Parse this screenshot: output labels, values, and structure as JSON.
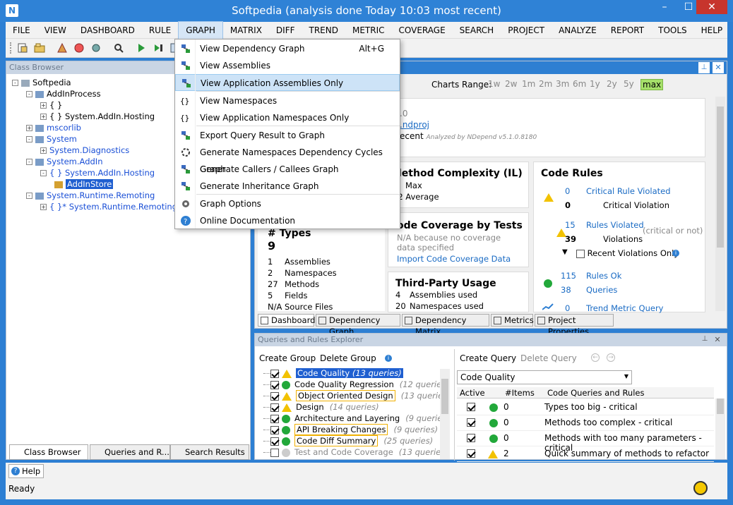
{
  "window": {
    "title": "Softpedia  (analysis done Today 10:03 most recent)",
    "minimize": "–",
    "maximize": "☐",
    "close": "✕"
  },
  "menubar": [
    "FILE",
    "VIEW",
    "DASHBOARD",
    "RULE",
    "GRAPH",
    "MATRIX",
    "DIFF",
    "TREND",
    "METRIC",
    "COVERAGE",
    "SEARCH",
    "PROJECT",
    "ANALYZE",
    "REPORT",
    "TOOLS",
    "HELP"
  ],
  "class_browser": {
    "title": "Class Browser",
    "tree": [
      {
        "text": "Softpedia",
        "indent": 0,
        "blue": false,
        "pm": "-",
        "icon": "solution"
      },
      {
        "text": "AddInProcess",
        "indent": 1,
        "blue": false,
        "pm": "-",
        "icon": "asm"
      },
      {
        "text": "{ }",
        "indent": 2,
        "blue": false,
        "pm": "+",
        "icon": "ns"
      },
      {
        "text": "{ }  System.AddIn.Hosting",
        "indent": 2,
        "blue": false,
        "pm": "+",
        "icon": "ns"
      },
      {
        "text": "mscorlib",
        "indent": 1,
        "blue": true,
        "pm": "+",
        "icon": "asm"
      },
      {
        "text": "System",
        "indent": 1,
        "blue": true,
        "pm": "-",
        "icon": "asm"
      },
      {
        "text": "System.Diagnostics",
        "indent": 2,
        "blue": true,
        "pm": "+",
        "icon": "ns"
      },
      {
        "text": "System.AddIn",
        "indent": 1,
        "blue": true,
        "pm": "-",
        "icon": "asm"
      },
      {
        "text": "{ }  System.AddIn.Hosting",
        "indent": 2,
        "blue": true,
        "pm": "-",
        "icon": "ns"
      },
      {
        "text": "AddInStore",
        "indent": 3,
        "blue": false,
        "pm": "",
        "icon": "class",
        "selected": true
      },
      {
        "text": "System.Runtime.Remoting",
        "indent": 1,
        "blue": true,
        "pm": "-",
        "icon": "asm"
      },
      {
        "text": "{ }*  System.Runtime.Remoting.Chann",
        "indent": 2,
        "blue": true,
        "pm": "+",
        "icon": "ns"
      }
    ],
    "tabs": [
      "Class Browser",
      "Queries and R...",
      "Search Results"
    ]
  },
  "graph_menu": {
    "items": [
      {
        "label": "View Dependency Graph",
        "shortcut": "Alt+G",
        "icon": "dep-graph-icon"
      },
      {
        "label": "View Assemblies",
        "shortcut": "",
        "icon": "assemblies-icon"
      },
      {
        "label": "View Application Assemblies Only",
        "shortcut": "",
        "icon": "app-assemblies-icon",
        "highlight": true
      },
      {
        "label": "View Namespaces",
        "shortcut": "",
        "icon": "namespaces-icon"
      },
      {
        "label": "View Application Namespaces Only",
        "shortcut": "",
        "icon": "app-namespaces-icon"
      },
      {
        "label": "Export Query Result to Graph",
        "shortcut": "",
        "icon": "export-graph-icon"
      },
      {
        "label": "Generate Namespaces Dependency Cycles Graph",
        "shortcut": "",
        "icon": "cycles-icon"
      },
      {
        "label": "Generate Callers / Callees Graph",
        "shortcut": "",
        "icon": "callers-icon"
      },
      {
        "label": "Generate Inheritance Graph",
        "shortcut": "",
        "icon": "inheritance-icon"
      },
      {
        "label": "Graph Options",
        "shortcut": "",
        "icon": "gear-icon"
      },
      {
        "label": "Online Documentation",
        "shortcut": "",
        "icon": "help-icon"
      }
    ]
  },
  "dashboard": {
    "charts_range_label": "Charts Range:",
    "ranges": [
      "1w",
      "2w",
      "1m",
      "2m",
      "3m",
      "6m",
      "1y",
      "2y",
      "5y",
      "max"
    ],
    "info": {
      "version": ".0",
      "proj": ".ndproj",
      "recent": "ecent",
      "analyzed": "Analyzed by NDepend v5.1.0.8180"
    },
    "complexity": {
      "title": "lethod Complexity (IL)",
      "max_label": "Max",
      "avg_value": "22",
      "avg_label": "Average"
    },
    "coverage": {
      "title": "ode Coverage by Tests",
      "na": "N/A because no coverage",
      "na2": "data specified",
      "link": "Import Code Coverage Data"
    },
    "types": {
      "title": "# Types",
      "count": "9",
      "rows": [
        [
          "1",
          "Assemblies"
        ],
        [
          "2",
          "Namespaces"
        ],
        [
          "27",
          "Methods"
        ],
        [
          "5",
          "Fields"
        ],
        [
          "N/A",
          "Source Files"
        ]
      ]
    },
    "third_party": {
      "title": "Third-Party Usage",
      "rows": [
        [
          "4",
          "Assemblies used"
        ],
        [
          "20",
          "Namespaces used"
        ]
      ]
    },
    "rules": {
      "title": "Code Rules",
      "critical_count": "0",
      "critical_link": "Critical Rule Violated",
      "critical_v": "0",
      "critical_v_label": "Critical Violation",
      "rules_count": "15",
      "rules_link": "Rules Violated",
      "rules_v": "39",
      "rules_v_label": "Violations",
      "rules_note": "(critical or not)",
      "recent_label": "Recent Violations Only",
      "ok_count": "115",
      "ok_link": "Rules Ok",
      "q_count": "38",
      "q_link": "Queries",
      "trend_count": "0",
      "trend_link": "Trend Metric Query"
    },
    "tabs": [
      "Dashboard",
      "Dependency Graph",
      "Dependency Matrix",
      "Metrics",
      "Project Properties"
    ]
  },
  "qre": {
    "title": "Queries and Rules Explorer",
    "create_group": "Create Group",
    "delete_group": "Delete Group",
    "groups": [
      {
        "name": "Code Quality",
        "count": "(13 queries)",
        "status": "warn",
        "selected": true,
        "checked": true
      },
      {
        "name": "Code Quality Regression",
        "count": "(12 queries)",
        "status": "ok",
        "checked": true
      },
      {
        "name": "Object Oriented Design",
        "count": "(13 queries)",
        "status": "warn",
        "boxed": true,
        "checked": true
      },
      {
        "name": "Design",
        "count": "(14 queries)",
        "status": "warn",
        "checked": true
      },
      {
        "name": "Architecture and Layering",
        "count": "(9 queries)",
        "status": "ok",
        "checked": true
      },
      {
        "name": "API Breaking Changes",
        "count": "(9 queries)",
        "status": "ok",
        "boxed": true,
        "checked": true
      },
      {
        "name": "Code Diff Summary",
        "count": "(25 queries)",
        "status": "ok",
        "boxed": true,
        "checked": true
      },
      {
        "name": "Test and Code Coverage",
        "count": "(13 queries)",
        "status": "grey",
        "checked": false,
        "grey": true
      }
    ],
    "create_query": "Create Query",
    "delete_query": "Delete Query",
    "selected_group": "Code Quality",
    "cols": [
      "Active",
      "#Items",
      "Code Queries and Rules"
    ],
    "rows": [
      {
        "items": "0",
        "name": "Types too big - critical",
        "status": "ok"
      },
      {
        "items": "0",
        "name": "Methods too complex - critical",
        "status": "ok"
      },
      {
        "items": "0",
        "name": "Methods with too many parameters - critical",
        "status": "ok"
      },
      {
        "items": "2",
        "name": "Quick summary of methods to refactor",
        "status": "warn"
      }
    ]
  },
  "status": {
    "help": "Help",
    "ready": "Ready"
  },
  "colors": {
    "accent": "#2f82d6",
    "link": "#1a6bc4",
    "ok": "#22a83a",
    "warn": "#f2c200"
  }
}
